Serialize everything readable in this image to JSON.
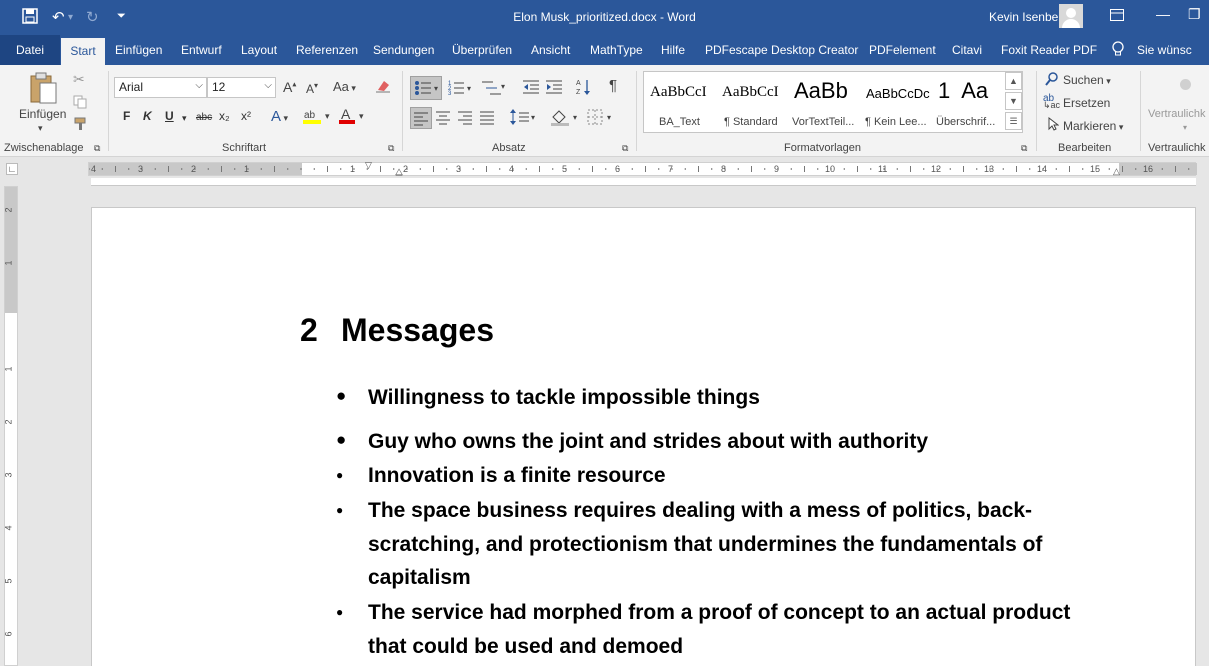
{
  "title_bar": {
    "document_title": "Elon Musk_prioritized.docx  -  Word",
    "user_name": "Kevin Isenberg"
  },
  "tabs": {
    "datei": "Datei",
    "start": "Start",
    "items": [
      "Einfügen",
      "Entwurf",
      "Layout",
      "Referenzen",
      "Sendungen",
      "Überprüfen",
      "Ansicht",
      "MathType",
      "Hilfe",
      "PDFescape Desktop Creator",
      "PDFelement",
      "Citavi",
      "Foxit Reader PDF"
    ],
    "tell_me": "Sie wünsc"
  },
  "ribbon": {
    "clipboard": {
      "paste_label": "Einfügen",
      "group_label": "Zwischenablage"
    },
    "font": {
      "font_name": "Arial",
      "font_size": "12",
      "bold": "F",
      "italic": "K",
      "underline": "U",
      "strike": "abc",
      "sub": "x₂",
      "sup": "x²",
      "group_label": "Schriftart",
      "case": "Aa"
    },
    "paragraph": {
      "group_label": "Absatz"
    },
    "styles": {
      "group_label": "Formatvorlagen",
      "items": [
        {
          "preview": "AaBbCcI",
          "name": "BA_Text"
        },
        {
          "preview": "AaBbCcI",
          "name": "¶ Standard"
        },
        {
          "preview": "AaBb",
          "name": "VorTextTeil..."
        },
        {
          "preview": "AaBbCcDc",
          "name": "¶ Kein Lee..."
        },
        {
          "preview": "1  Aa",
          "name": "Überschrif..."
        }
      ]
    },
    "editing": {
      "find": "Suchen",
      "replace": "Ersetzen",
      "select": "Markieren",
      "group_label": "Bearbeiten"
    },
    "sensitivity": {
      "label": "Vertraulichk",
      "group_label": "Vertraulichk"
    }
  },
  "ruler": {
    "h_left": [
      "4",
      "3",
      "2",
      "1"
    ],
    "h_right": [
      "1",
      "2",
      "3",
      "4",
      "5",
      "6",
      "7",
      "8",
      "9",
      "10",
      "11",
      "12",
      "13",
      "14",
      "15",
      "16"
    ],
    "v": [
      "2",
      "1",
      "1",
      "2",
      "3",
      "4",
      "5",
      "6"
    ]
  },
  "document": {
    "heading_number": "2",
    "heading_text": "Messages",
    "lines": [
      "Willingness to tackle impossible things",
      "Guy who owns the joint and strides about with authority",
      "Innovation is a finite resource",
      "The space business requires dealing with a mess of politics, back-",
      "scratching, and protectionism that undermines the fundamentals of",
      "capitalism",
      "The service had morphed from a proof of concept to an actual product",
      "that could be used and demoed"
    ]
  }
}
